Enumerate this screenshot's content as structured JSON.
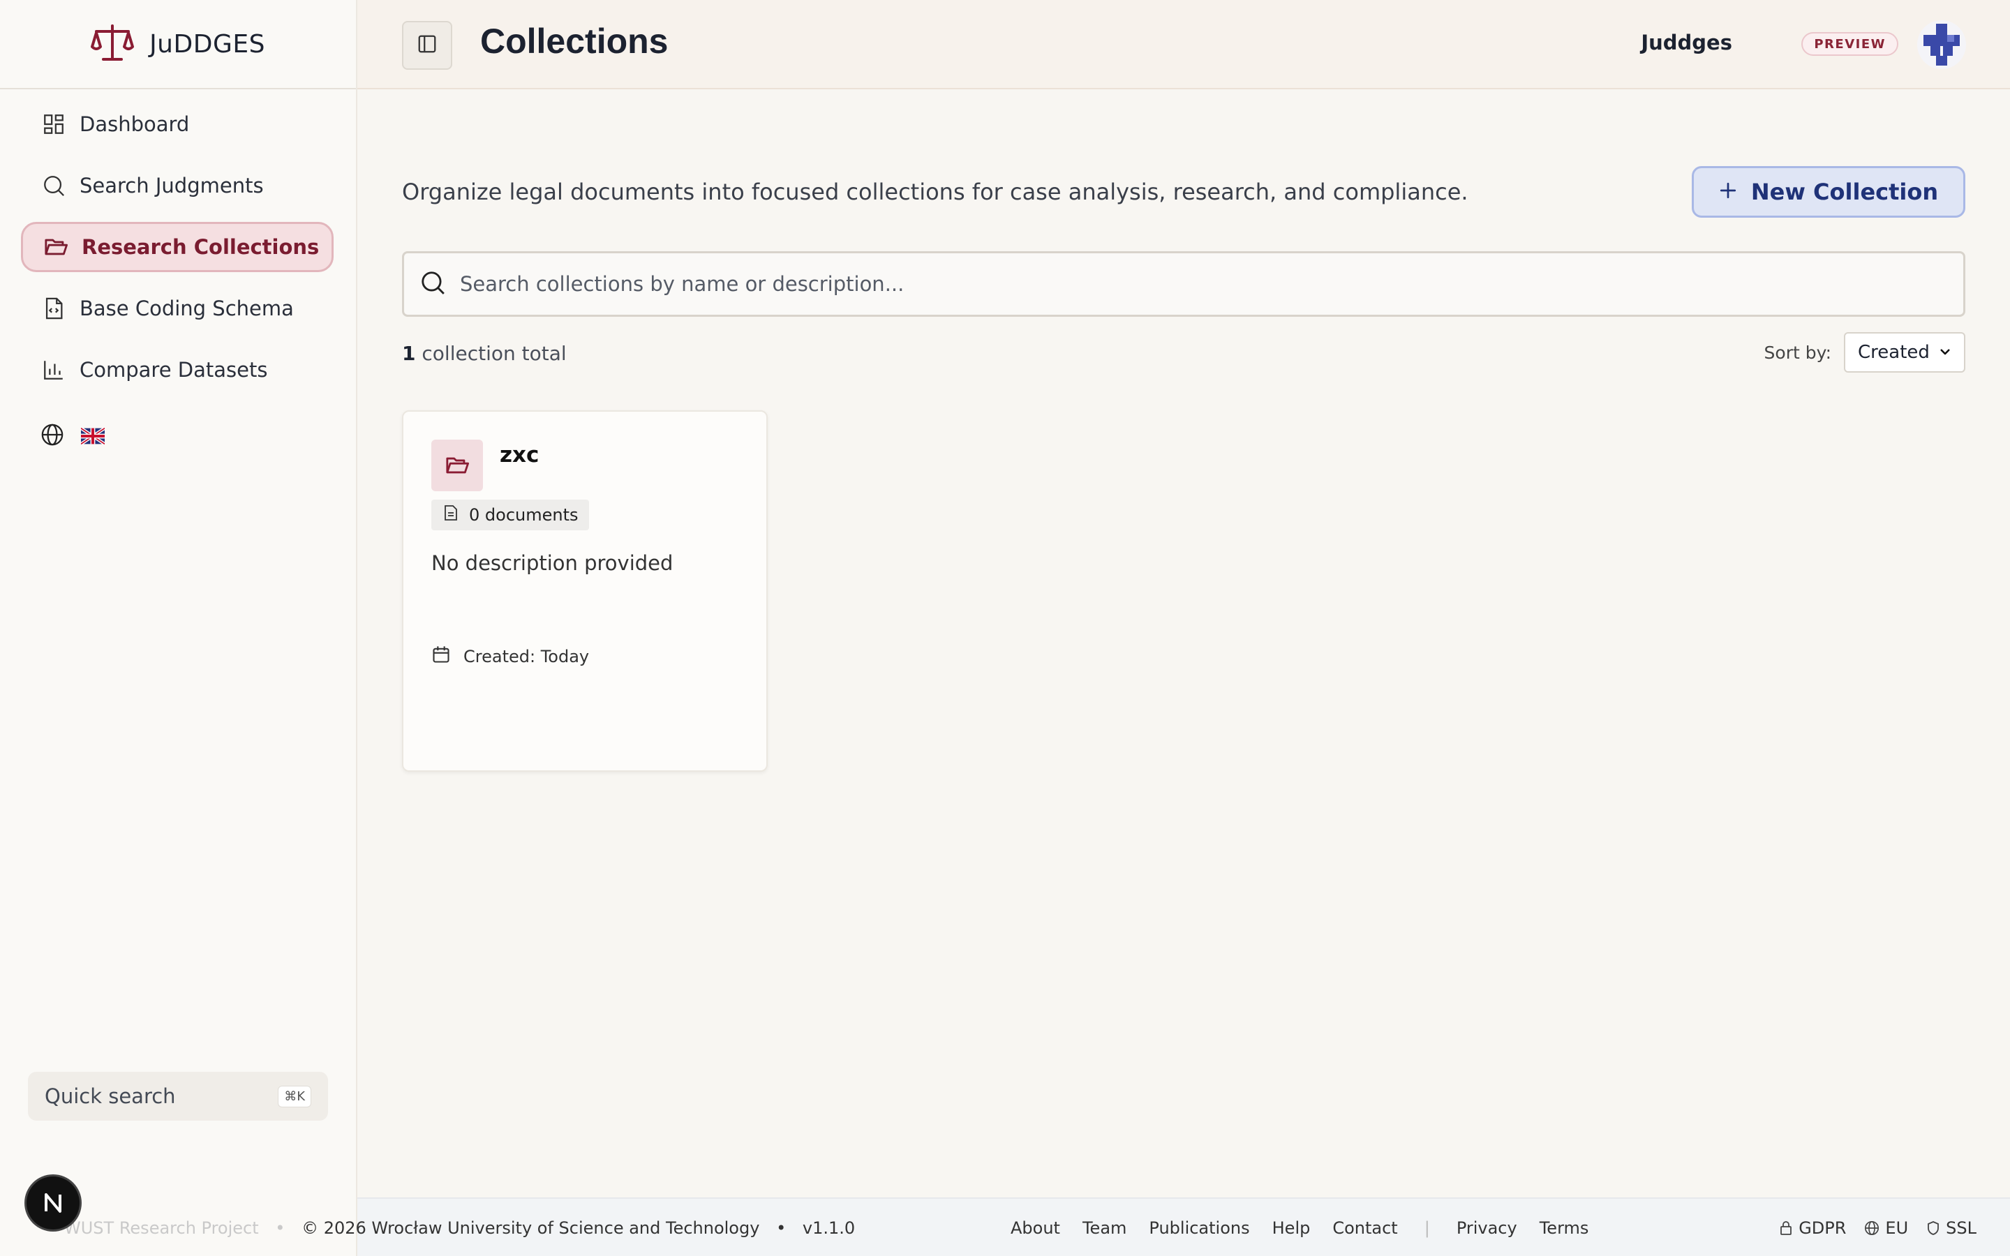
{
  "app": {
    "brand": "JuDDGES",
    "colors": {
      "accent": "#7a1c30",
      "primary": "#1f3278"
    }
  },
  "sidebar": {
    "items": [
      {
        "label": "Dashboard",
        "icon": "dashboard-icon",
        "active": false
      },
      {
        "label": "Search Judgments",
        "icon": "search-icon",
        "active": false
      },
      {
        "label": "Research Collections",
        "icon": "folder-open-icon",
        "active": true
      },
      {
        "label": "Base Coding Schema",
        "icon": "file-code-icon",
        "active": false
      },
      {
        "label": "Compare Datasets",
        "icon": "bar-chart-icon",
        "active": false
      }
    ],
    "language_icon": "globe-icon",
    "language_flag": "uk-flag",
    "quick_search": {
      "label": "Quick search",
      "shortcut": "⌘K"
    }
  },
  "header": {
    "title": "Collections",
    "user_name": "Juddges",
    "badge": "PREVIEW"
  },
  "main": {
    "intro": "Organize legal documents into focused collections for case analysis, research, and compliance.",
    "new_button": "New Collection",
    "search_placeholder": "Search collections by name or description...",
    "count_number": "1",
    "count_text": " collection total",
    "sort_label": "Sort by:",
    "sort_value": "Created",
    "collections": [
      {
        "name": "zxc",
        "documents": "0 documents",
        "description": "No description provided",
        "created": "Created: Today"
      }
    ]
  },
  "footer": {
    "project": "WUST Research Project",
    "copyright": "© 2026 Wrocław University of Science and Technology",
    "version": "v1.1.0",
    "links": [
      "About",
      "Team",
      "Publications",
      "Help",
      "Contact"
    ],
    "legal_links": [
      "Privacy",
      "Terms"
    ],
    "badges": [
      "GDPR",
      "EU",
      "SSL"
    ]
  }
}
